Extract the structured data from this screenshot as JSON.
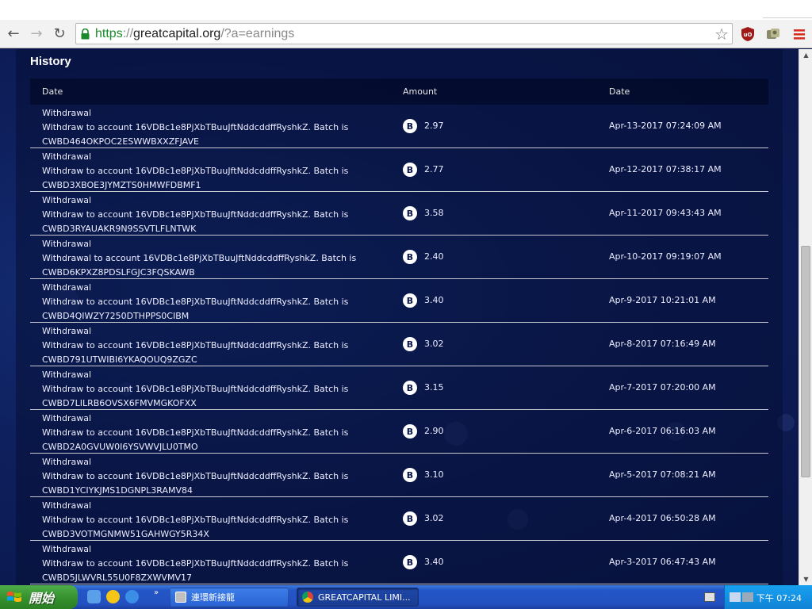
{
  "browser": {
    "url_scheme": "https",
    "url_sep": "://",
    "url_host": "greatcapital.org",
    "url_path": "/?a=earnings",
    "icons": [
      "back-arrow-icon",
      "forward-arrow-icon",
      "reload-icon",
      "lock-icon",
      "star-icon",
      "ublock-icon",
      "extension-icon",
      "menu-icon"
    ]
  },
  "page": {
    "section_title": "History",
    "columns": [
      "Date",
      "Amount",
      "Date"
    ],
    "rows": [
      {
        "type": "Withdrawal",
        "line2": "Withdraw to account 16VDBc1e8PjXbTBuuJftNddcddffRyshkZ. Batch is",
        "batch": "CWBD464OKPOC2ESWWBXXZFJAVE",
        "amount": "2.97",
        "date": "Apr-13-2017 07:24:09 AM"
      },
      {
        "type": "Withdrawal",
        "line2": "Withdraw to account 16VDBc1e8PjXbTBuuJftNddcddffRyshkZ. Batch is",
        "batch": "CWBD3XBOE3JYMZTS0HMWFDBMF1",
        "amount": "2.77",
        "date": "Apr-12-2017 07:38:17 AM"
      },
      {
        "type": "Withdrawal",
        "line2": "Withdraw to account 16VDBc1e8PjXbTBuuJftNddcddffRyshkZ. Batch is",
        "batch": "CWBD3RYAUAKR9N9SSVTLFLNTWK",
        "amount": "3.58",
        "date": "Apr-11-2017 09:43:43 AM"
      },
      {
        "type": "Withdrawal",
        "line2": "Withdrawal to account 16VDBc1e8PjXbTBuuJftNddcddffRyshkZ. Batch is",
        "batch": "CWBD6KPXZ8PDSLFGJC3FQSKAWB",
        "amount": "2.40",
        "date": "Apr-10-2017 09:19:07 AM"
      },
      {
        "type": "Withdrawal",
        "line2": "Withdraw to account 16VDBc1e8PjXbTBuuJftNddcddffRyshkZ. Batch is",
        "batch": "CWBD4QIWZY7250DTHPPS0CIBM",
        "amount": "3.40",
        "date": "Apr-9-2017 10:21:01 AM"
      },
      {
        "type": "Withdrawal",
        "line2": "Withdraw to account 16VDBc1e8PjXbTBuuJftNddcddffRyshkZ. Batch is",
        "batch": "CWBD791UTWIBI6YKAQOUQ9ZGZC",
        "amount": "3.02",
        "date": "Apr-8-2017 07:16:49 AM"
      },
      {
        "type": "Withdrawal",
        "line2": "Withdraw to account 16VDBc1e8PjXbTBuuJftNddcddffRyshkZ. Batch is",
        "batch": "CWBD7LILRB6OVSX6FMVMGKOFXX",
        "amount": "3.15",
        "date": "Apr-7-2017 07:20:00 AM"
      },
      {
        "type": "Withdrawal",
        "line2": "Withdraw to account 16VDBc1e8PjXbTBuuJftNddcddffRyshkZ. Batch is",
        "batch": "CWBD2A0GVUW0I6YSVWVJLU0TMO",
        "amount": "2.90",
        "date": "Apr-6-2017 06:16:03 AM"
      },
      {
        "type": "Withdrawal",
        "line2": "Withdraw to account 16VDBc1e8PjXbTBuuJftNddcddffRyshkZ. Batch is",
        "batch": "CWBD1YCIYKJMS1DGNPL3RAMV84",
        "amount": "3.10",
        "date": "Apr-5-2017 07:08:21 AM"
      },
      {
        "type": "Withdrawal",
        "line2": "Withdraw to account 16VDBc1e8PjXbTBuuJftNddcddffRyshkZ. Batch is",
        "batch": "CWBD3VOTMGNMW51GAHWGY5R34X",
        "amount": "3.02",
        "date": "Apr-4-2017 06:50:28 AM"
      },
      {
        "type": "Withdrawal",
        "line2": "Withdraw to account 16VDBc1e8PjXbTBuuJftNddcddffRyshkZ. Batch is",
        "batch": "CWBD5JLWVRL55U0F8ZXWVMV17",
        "amount": "3.40",
        "date": "Apr-3-2017 06:47:43 AM"
      }
    ],
    "coin_symbol": "B"
  },
  "taskbar": {
    "start_label": "開始",
    "more": "»",
    "tasks": [
      {
        "label": "連環新接龍"
      },
      {
        "label": "GREATCAPITAL LIMI..."
      }
    ],
    "clock": "下午 07:24"
  },
  "colors": {
    "background": "#0d1a4a",
    "ssl_green": "#1a8a2a",
    "ublock_red": "#a01818",
    "menu_red": "#d93025"
  }
}
